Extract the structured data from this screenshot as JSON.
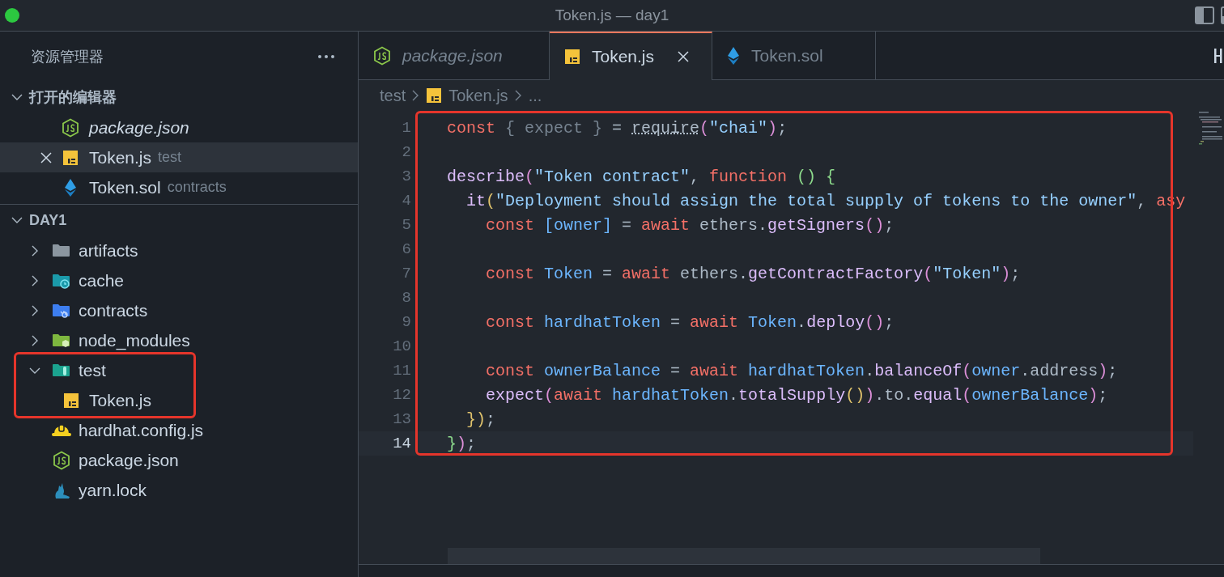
{
  "window": {
    "title": "Token.js — day1"
  },
  "sidebar": {
    "title": "资源管理器",
    "open_editors": {
      "title": "打开的编辑器",
      "expanded": true,
      "items": [
        {
          "name": "package.json",
          "kind": "json",
          "preview": true,
          "selected": false
        },
        {
          "name": "Token.js",
          "folder": "test",
          "kind": "js",
          "preview": false,
          "selected": true
        },
        {
          "name": "Token.sol",
          "folder": "contracts",
          "kind": "sol",
          "preview": false,
          "selected": false
        }
      ]
    },
    "explorer": {
      "title": "DAY1",
      "expanded": true,
      "items": [
        {
          "name": "artifacts",
          "kind": "folder",
          "expanded": false,
          "highlighted": false
        },
        {
          "name": "cache",
          "kind": "folder-cache",
          "expanded": false,
          "highlighted": false
        },
        {
          "name": "contracts",
          "kind": "folder-contracts",
          "expanded": false,
          "highlighted": false
        },
        {
          "name": "node_modules",
          "kind": "folder-node",
          "expanded": false,
          "highlighted": false
        },
        {
          "name": "test",
          "kind": "folder-test",
          "expanded": true,
          "highlighted": true,
          "children": [
            {
              "name": "Token.js",
              "kind": "js"
            }
          ]
        },
        {
          "name": "hardhat.config.js",
          "kind": "hardhat"
        },
        {
          "name": "package.json",
          "kind": "json"
        },
        {
          "name": "yarn.lock",
          "kind": "yarn"
        }
      ]
    }
  },
  "tabs": [
    {
      "label": "package.json",
      "kind": "json",
      "preview": true,
      "selected": false
    },
    {
      "label": "Token.js",
      "kind": "js",
      "preview": false,
      "selected": true
    },
    {
      "label": "Token.sol",
      "kind": "sol",
      "preview": false,
      "selected": false
    }
  ],
  "breadcrumb": [
    {
      "label": "test"
    },
    {
      "label": "Token.js",
      "kind": "js"
    },
    {
      "label": "..."
    }
  ],
  "editor": {
    "highlighted": true,
    "lines": [
      {
        "number": "1",
        "current": false,
        "tokens": [
          {
            "kind": "kw",
            "text": "const"
          },
          {
            "kind": "dim",
            "text": " { expect } "
          },
          {
            "kind": "txt",
            "text": "= "
          },
          {
            "kind": "hint",
            "text": "require"
          },
          {
            "kind": "b1",
            "text": "("
          },
          {
            "kind": "str",
            "text": "\"chai\""
          },
          {
            "kind": "b1",
            "text": ")"
          },
          {
            "kind": "txt",
            "text": ";"
          }
        ]
      },
      {
        "number": "2",
        "current": false
      },
      {
        "number": "3",
        "current": false,
        "tokens": [
          {
            "kind": "fn",
            "text": "describe"
          },
          {
            "kind": "b1",
            "text": "("
          },
          {
            "kind": "str",
            "text": "\"Token contract\""
          },
          {
            "kind": "txt",
            "text": ", "
          },
          {
            "kind": "kw",
            "text": "function "
          },
          {
            "kind": "b3",
            "text": "() {"
          }
        ]
      },
      {
        "number": "4",
        "current": false,
        "tokens": [
          {
            "kind": "fn",
            "text": "  it"
          },
          {
            "kind": "b2",
            "text": "("
          },
          {
            "kind": "str",
            "text": "\"Deployment should assign the total supply of tokens to the owner\""
          },
          {
            "kind": "txt",
            "text": ", "
          },
          {
            "kind": "kw",
            "text": "asy"
          }
        ]
      },
      {
        "number": "5",
        "current": false,
        "tokens": [
          {
            "kind": "kw",
            "text": "    const "
          },
          {
            "kind": "var",
            "text": "[owner]"
          },
          {
            "kind": "txt",
            "text": " = "
          },
          {
            "kind": "kw",
            "text": "await"
          },
          {
            "kind": "txt",
            "text": " ethers."
          },
          {
            "kind": "fn",
            "text": "getSigners"
          },
          {
            "kind": "b1",
            "text": "()"
          },
          {
            "kind": "txt",
            "text": ";"
          }
        ]
      },
      {
        "number": "6",
        "current": false
      },
      {
        "number": "7",
        "current": false,
        "tokens": [
          {
            "kind": "kw",
            "text": "    const "
          },
          {
            "kind": "var",
            "text": "Token"
          },
          {
            "kind": "txt",
            "text": " = "
          },
          {
            "kind": "kw",
            "text": "await"
          },
          {
            "kind": "txt",
            "text": " ethers."
          },
          {
            "kind": "fn",
            "text": "getContractFactory"
          },
          {
            "kind": "b1",
            "text": "("
          },
          {
            "kind": "str",
            "text": "\"Token\""
          },
          {
            "kind": "b1",
            "text": ")"
          },
          {
            "kind": "txt",
            "text": ";"
          }
        ]
      },
      {
        "number": "8",
        "current": false
      },
      {
        "number": "9",
        "current": false,
        "tokens": [
          {
            "kind": "kw",
            "text": "    const "
          },
          {
            "kind": "var",
            "text": "hardhatToken"
          },
          {
            "kind": "txt",
            "text": " = "
          },
          {
            "kind": "kw",
            "text": "await "
          },
          {
            "kind": "var",
            "text": "Token"
          },
          {
            "kind": "txt",
            "text": "."
          },
          {
            "kind": "fn",
            "text": "deploy"
          },
          {
            "kind": "b1",
            "text": "()"
          },
          {
            "kind": "txt",
            "text": ";"
          }
        ]
      },
      {
        "number": "10",
        "current": false
      },
      {
        "number": "11",
        "current": false,
        "tokens": [
          {
            "kind": "kw",
            "text": "    const "
          },
          {
            "kind": "var",
            "text": "ownerBalance"
          },
          {
            "kind": "txt",
            "text": " = "
          },
          {
            "kind": "kw",
            "text": "await "
          },
          {
            "kind": "var",
            "text": "hardhatToken"
          },
          {
            "kind": "txt",
            "text": "."
          },
          {
            "kind": "fn",
            "text": "balanceOf"
          },
          {
            "kind": "b1",
            "text": "("
          },
          {
            "kind": "var",
            "text": "owner"
          },
          {
            "kind": "txt",
            "text": ".address"
          },
          {
            "kind": "b1",
            "text": ")"
          },
          {
            "kind": "txt",
            "text": ";"
          }
        ]
      },
      {
        "number": "12",
        "current": false,
        "tokens": [
          {
            "kind": "fn",
            "text": "    expect"
          },
          {
            "kind": "b1",
            "text": "("
          },
          {
            "kind": "kw",
            "text": "await "
          },
          {
            "kind": "var",
            "text": "hardhatToken"
          },
          {
            "kind": "txt",
            "text": "."
          },
          {
            "kind": "fn",
            "text": "totalSupply"
          },
          {
            "kind": "b2",
            "text": "()"
          },
          {
            "kind": "b1",
            "text": ")"
          },
          {
            "kind": "txt",
            "text": ".to."
          },
          {
            "kind": "fn",
            "text": "equal"
          },
          {
            "kind": "b1",
            "text": "("
          },
          {
            "kind": "var",
            "text": "ownerBalance"
          },
          {
            "kind": "b1",
            "text": ")"
          },
          {
            "kind": "txt",
            "text": ";"
          }
        ]
      },
      {
        "number": "13",
        "current": false,
        "tokens": [
          {
            "kind": "b2",
            "text": "  })"
          },
          {
            "kind": "txt",
            "text": ";"
          }
        ]
      },
      {
        "number": "14",
        "current": true,
        "tokens": [
          {
            "kind": "b3",
            "text": "}"
          },
          {
            "kind": "b1",
            "text": ")"
          },
          {
            "kind": "txt",
            "text": ";"
          }
        ]
      }
    ]
  }
}
